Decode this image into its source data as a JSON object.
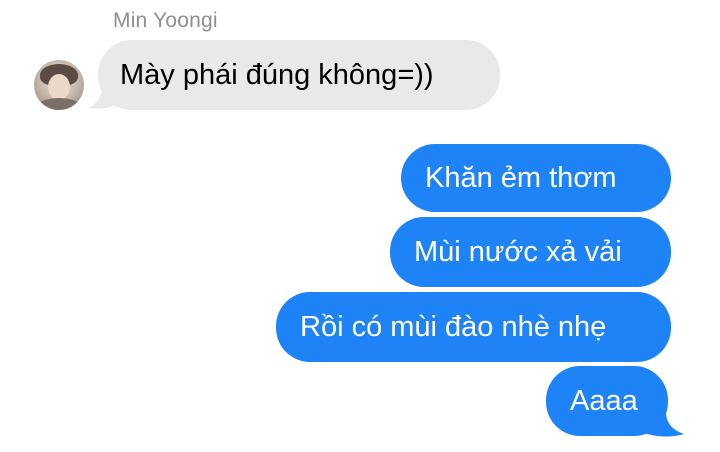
{
  "conversation": {
    "sender_name": "Min Yoongi",
    "messages": [
      {
        "direction": "incoming",
        "text": "Mày phái đúng không=))"
      },
      {
        "direction": "outgoing",
        "text": "Khăn ẻm thơm"
      },
      {
        "direction": "outgoing",
        "text": "Mùi nước xả vải"
      },
      {
        "direction": "outgoing",
        "text": "Rồi có mùi đào nhè nhẹ"
      },
      {
        "direction": "outgoing",
        "text": "Aaaa"
      }
    ]
  },
  "colors": {
    "incoming_bubble": "#e9e9eb",
    "outgoing_bubble": "#1e83f7",
    "sender_name": "#8e8e93"
  },
  "icons": {
    "avatar": "avatar-photo"
  }
}
